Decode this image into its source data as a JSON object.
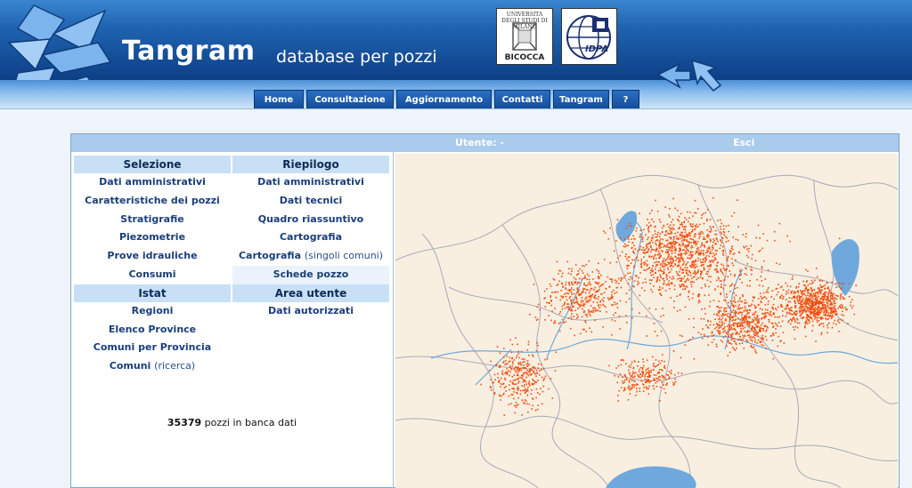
{
  "header": {
    "title": "Tangram",
    "subtitle": "database per pozzi",
    "university_logo": {
      "top_text": "UNIVERSITA DEGLI STUDI DI MILANO",
      "bottom_text": "BICOCCA"
    },
    "idpa_logo": {
      "text": "IDPA"
    }
  },
  "nav": [
    {
      "label": "Home"
    },
    {
      "label": "Consultazione"
    },
    {
      "label": "Aggiornamento"
    },
    {
      "label": "Contatti"
    },
    {
      "label": "Tangram"
    },
    {
      "label": "?"
    }
  ],
  "panel": {
    "user_label": "Utente: -",
    "exit_label": "Esci",
    "left": {
      "selezione": {
        "title": "Selezione",
        "items": [
          "Dati amministrativi",
          "Caratteristiche dei pozzi",
          "Stratigrafie",
          "Piezometrie",
          "Prove idrauliche",
          "Consumi"
        ]
      },
      "istat": {
        "title": "Istat",
        "items": [
          "Regioni",
          "Elenco Province",
          "Comuni per Provincia"
        ],
        "comuni": {
          "main": "Comuni",
          "note": "(ricerca)"
        }
      }
    },
    "right": {
      "riepilogo": {
        "title": "Riepilogo",
        "items": [
          "Dati amministrativi",
          "Dati tecnici",
          "Quadro riassuntivo",
          "Cartografia"
        ],
        "cartografia_singoli": {
          "main": "Cartografia",
          "note": "(singoli comuni)"
        },
        "schede": "Schede pozzo"
      },
      "area_utente": {
        "title": "Area utente",
        "items": [
          "Dati autorizzati"
        ]
      }
    },
    "count": {
      "value": "35379",
      "suffix": "pozzi in banca dati"
    }
  },
  "colors": {
    "header_dark": "#0d3f86",
    "nav_button": "#134d9c",
    "link_text": "#1a3e7a",
    "well_dot": "#f04e10",
    "map_land": "#f8efe0",
    "map_water": "#6fa8dc"
  }
}
